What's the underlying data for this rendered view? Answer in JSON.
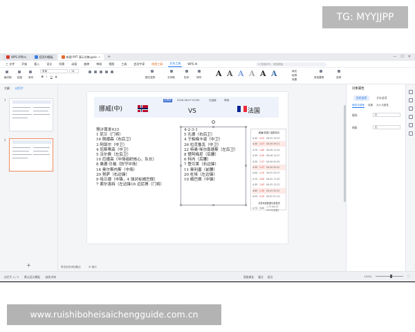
{
  "overlay": {
    "tg_text": "TG: MYYJJPP",
    "url_text": "www.ruishiboheisaichengguide.com.cn"
  },
  "window": {
    "tabs": [
      {
        "label": "WPS Office",
        "color": "#d9362b"
      },
      {
        "label": "稻壳AI模板",
        "color": "#3a7ce0"
      },
      {
        "label": "新建 PPT 演示文稿.pptx",
        "color": "#e4692a"
      }
    ],
    "new_tab": "+"
  },
  "menu": {
    "items": [
      "三 文件",
      "开始",
      "插入",
      "设计",
      "切换",
      "动画",
      "放映",
      "审阅",
      "视图",
      "工具",
      "会员专享",
      "绘图工具",
      "文本工具",
      "WPS AI"
    ],
    "active_index": 11,
    "search_placeholder": "Q 搜索命令、搜索模板"
  },
  "ribbon": {
    "labels": {
      "format_painter": "格式刷",
      "paste": "粘贴",
      "cut": "剪切",
      "font": "宋体",
      "font_size": "14",
      "arrange": "排列",
      "shape": "形状",
      "image_text": "图文混排",
      "textbox": "文本框",
      "text_fill": "填充",
      "text_outline": "轮廓",
      "text_effect": "效果",
      "find_replace": "查找替换",
      "select": "选择"
    }
  },
  "left_panel": {
    "tabs": [
      "大纲",
      "幻灯片"
    ],
    "slides": [
      "1",
      "2"
    ],
    "add": "+"
  },
  "slide": {
    "badge": "世界杯",
    "time": "2026-06-07 03:00",
    "status": "已结束",
    "location": "场地",
    "team_left": "挪威(中)",
    "vs": "VS",
    "team_right": "法国",
    "formation_right": "4-2-3-1",
    "left_lineup": [
      "预计首发433",
      "1 尼兰（门将）",
      "16 佩德森（右后卫）",
      "3 阿耶尔（中卫）",
      "4 厄斯蒂高（中卫）",
      "5 沃尔费（左后卫）",
      "10 厄德高（中场组织核心、队长）",
      "8 桑德·贝格（防守中场）",
      "14 奥尔斯内斯（中场）",
      "20 努萨（右边锋）",
      "9 哈兰德（中锋，4 球对标姆巴佩）",
      "7 索尔洛特（左边锋16 迈尼昂（门将）"
    ],
    "right_lineup": [
      "5 孔德（右后卫）",
      "4 于帕梅卡诺（中卫）",
      "26 拉克鲁瓦（中卫）",
      "22 特奥·埃尔南德斯（左后卫）",
      "8 楚阿梅尼（后腰）",
      "6 科内（后腰）",
      "7 登贝莱（右边锋）",
      "11 奥利塞（前腰）",
      "20 杜埃（左边锋）",
      "10 姆巴佩（中锋）"
    ],
    "odds": {
      "title": "威廉(英国) 指数变化",
      "rows": [
        [
          "4.35",
          "4.02",
          "06-05 19:03"
        ],
        [
          "4.40",
          "1.57",
          "06-06 09:21"
        ],
        [
          "4.70",
          "1.80",
          "06-06 13:44"
        ],
        [
          "4.35",
          "4.30",
          "06-06 12:07"
        ],
        [
          "4.20",
          "1.57",
          "06-06 00:29"
        ],
        [
          "4.35",
          "1.57",
          "06-06 00:41"
        ],
        [
          "4.50",
          "4.30",
          "06-05 20:07"
        ],
        [
          "4.70",
          "4.60",
          "06-05 17:40"
        ],
        [
          "4.35",
          "1.63",
          "06-05 13:22"
        ],
        [
          "4.65",
          "1.30",
          "06-05 09:20"
        ],
        [
          "4.25",
          "4.30",
          "06-05 07:14"
        ]
      ],
      "footer": "共查询到数据请看更多",
      "last": [
        "4.70",
        "3.60",
        "1.70 06-23 03:42(初盘)"
      ]
    },
    "notes_label": "单击此处添加备注",
    "ai_label": "AI 演示"
  },
  "right_panel": {
    "title": "对象属性",
    "tabs": [
      "形状选项",
      "文本选项"
    ],
    "subtabs": [
      "填充与线条",
      "效果",
      "大小与属性"
    ],
    "rows": [
      {
        "label": "填充",
        "value": "无"
      },
      {
        "label": "线条",
        "value": "无"
      }
    ]
  },
  "status": {
    "slide_info": "幻灯片 2 / 2",
    "theme": "默认设计模板",
    "input": "缺失字体",
    "mid": [
      "智能美化",
      "备注",
      "批注"
    ],
    "zoom": "104%",
    "zoom_level": 0.55
  },
  "colors": {
    "accent": "#1a73e8",
    "orange": "#e26a1b",
    "badge": "#3e6fcf",
    "norway_red": "#ba0c2f",
    "norway_blue": "#00205b",
    "fr_blue": "#002395",
    "fr_red": "#ed2939"
  }
}
